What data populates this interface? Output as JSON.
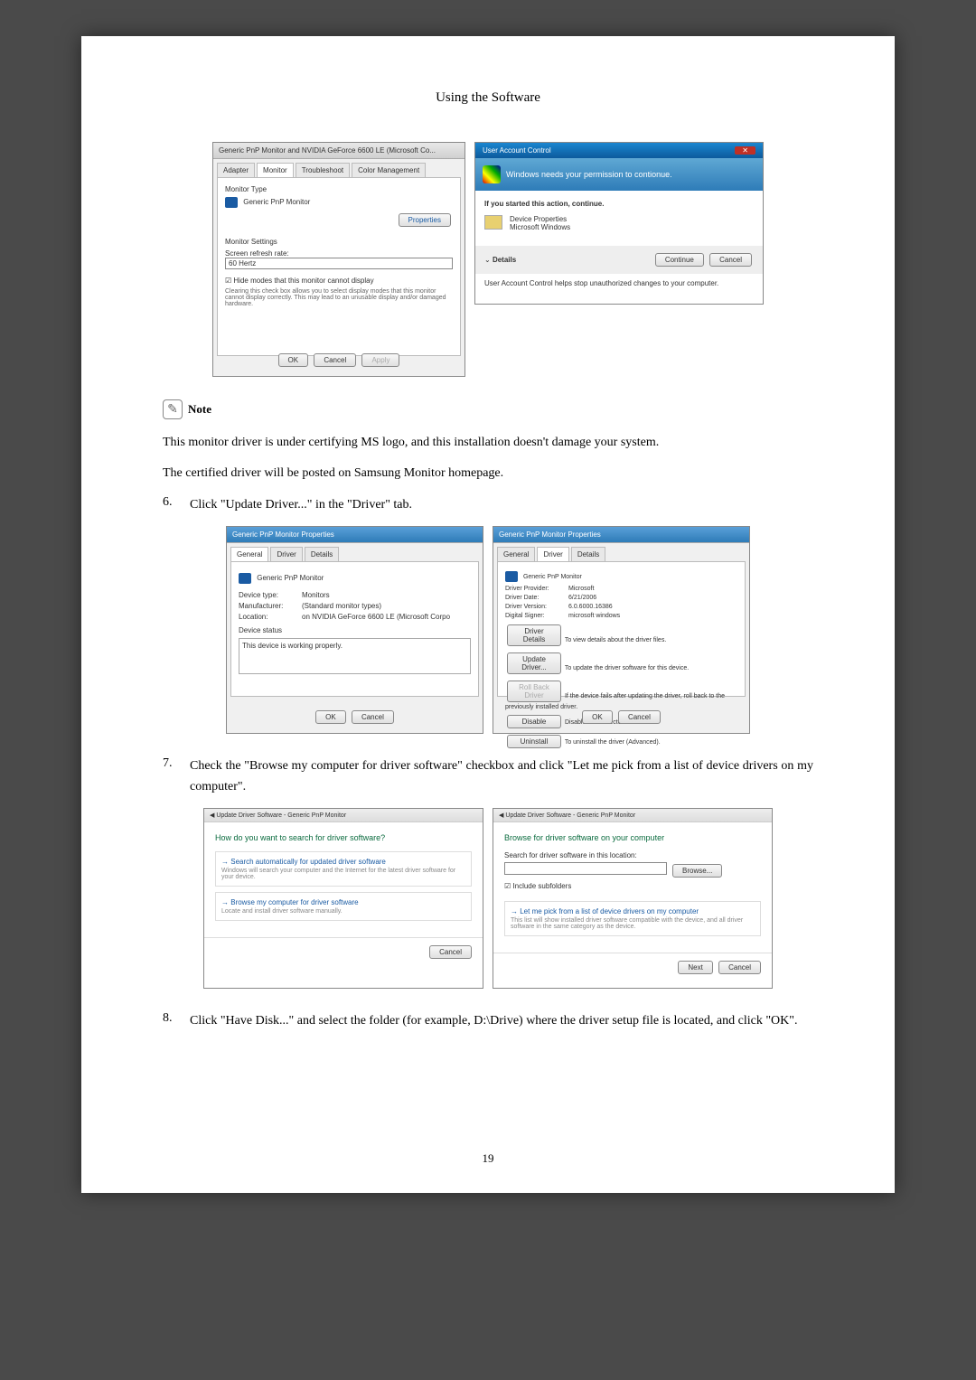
{
  "header": "Using the Software",
  "page_number": "19",
  "screenshot1": {
    "title": "Generic PnP Monitor and NVIDIA GeForce 6600 LE (Microsoft Co...",
    "tabs": [
      "Adapter",
      "Monitor",
      "Troubleshoot",
      "Color Management"
    ],
    "monitor_type_label": "Monitor Type",
    "monitor_name": "Generic PnP Monitor",
    "properties_btn": "Properties",
    "settings_label": "Monitor Settings",
    "refresh_label": "Screen refresh rate:",
    "refresh_value": "60 Hertz",
    "hide_checkbox": "Hide modes that this monitor cannot display",
    "hide_desc": "Clearing this check box allows you to select display modes that this monitor cannot display correctly. This may lead to an unusable display and/or damaged hardware.",
    "buttons": [
      "OK",
      "Cancel",
      "Apply"
    ]
  },
  "screenshot2": {
    "title": "User Account Control",
    "banner": "Windows needs your permission to contionue.",
    "started": "If you started this action, continue.",
    "item_title": "Device Properties",
    "item_sub": "Microsoft Windows",
    "details": "Details",
    "continue_btn": "Continue",
    "cancel_btn": "Cancel",
    "footer_text": "User Account Control helps stop unauthorized changes to your computer."
  },
  "note": {
    "label": "Note",
    "text1": "This monitor driver is under certifying MS logo, and this installation doesn't damage your system.",
    "text2": "The certified driver will be posted on Samsung Monitor homepage."
  },
  "step6": {
    "num": "6.",
    "text": "Click \"Update Driver...\" in the \"Driver\" tab."
  },
  "screenshot3": {
    "title": "Generic PnP Monitor Properties",
    "tabs": [
      "General",
      "Driver",
      "Details"
    ],
    "monitor_name": "Generic PnP Monitor",
    "device_type_label": "Device type:",
    "device_type": "Monitors",
    "manufacturer_label": "Manufacturer:",
    "manufacturer": "(Standard monitor types)",
    "location_label": "Location:",
    "location": "on NVIDIA GeForce 6600 LE (Microsoft Corpo",
    "status_label": "Device status",
    "status_text": "This device is working properly.",
    "buttons": [
      "OK",
      "Cancel"
    ]
  },
  "screenshot4": {
    "title": "Generic PnP Monitor Properties",
    "tabs": [
      "General",
      "Driver",
      "Details"
    ],
    "monitor_name": "Generic PnP Monitor",
    "provider_label": "Driver Provider:",
    "provider": "Microsoft",
    "date_label": "Driver Date:",
    "date": "6/21/2006",
    "version_label": "Driver Version:",
    "version": "6.0.6000.16386",
    "signer_label": "Digital Signer:",
    "signer": "microsoft windows",
    "btn_details": "Driver Details",
    "btn_details_desc": "To view details about the driver files.",
    "btn_update": "Update Driver...",
    "btn_update_desc": "To update the driver software for this device.",
    "btn_rollback": "Roll Back Driver",
    "btn_rollback_desc": "If the device fails after updating the driver, roll back to the previously installed driver.",
    "btn_disable": "Disable",
    "btn_disable_desc": "Disables the selected device.",
    "btn_uninstall": "Uninstall",
    "btn_uninstall_desc": "To uninstall the driver (Advanced).",
    "buttons": [
      "OK",
      "Cancel"
    ]
  },
  "step7": {
    "num": "7.",
    "text": "Check the \"Browse my computer for driver software\" checkbox and click \"Let me pick from a list of device drivers on my computer\"."
  },
  "screenshot5": {
    "title": "Update Driver Software - Generic PnP Monitor",
    "header": "How do you want to search for driver software?",
    "opt1_title": "Search automatically for updated driver software",
    "opt1_sub": "Windows will search your computer and the Internet for the latest driver software for your device.",
    "opt2_title": "Browse my computer for driver software",
    "opt2_sub": "Locate and install driver software manually.",
    "cancel": "Cancel"
  },
  "screenshot6": {
    "title": "Update Driver Software - Generic PnP Monitor",
    "header": "Browse for driver software on your computer",
    "search_label": "Search for driver software in this location:",
    "browse_btn": "Browse...",
    "include_sub": "Include subfolders",
    "opt_title": "Let me pick from a list of device drivers on my computer",
    "opt_sub": "This list will show installed driver software compatible with the device, and all driver software in the same category as the device.",
    "next": "Next",
    "cancel": "Cancel"
  },
  "step8": {
    "num": "8.",
    "text": "Click \"Have Disk...\" and select the folder (for example, D:\\Drive) where the driver setup file is located, and click \"OK\"."
  }
}
